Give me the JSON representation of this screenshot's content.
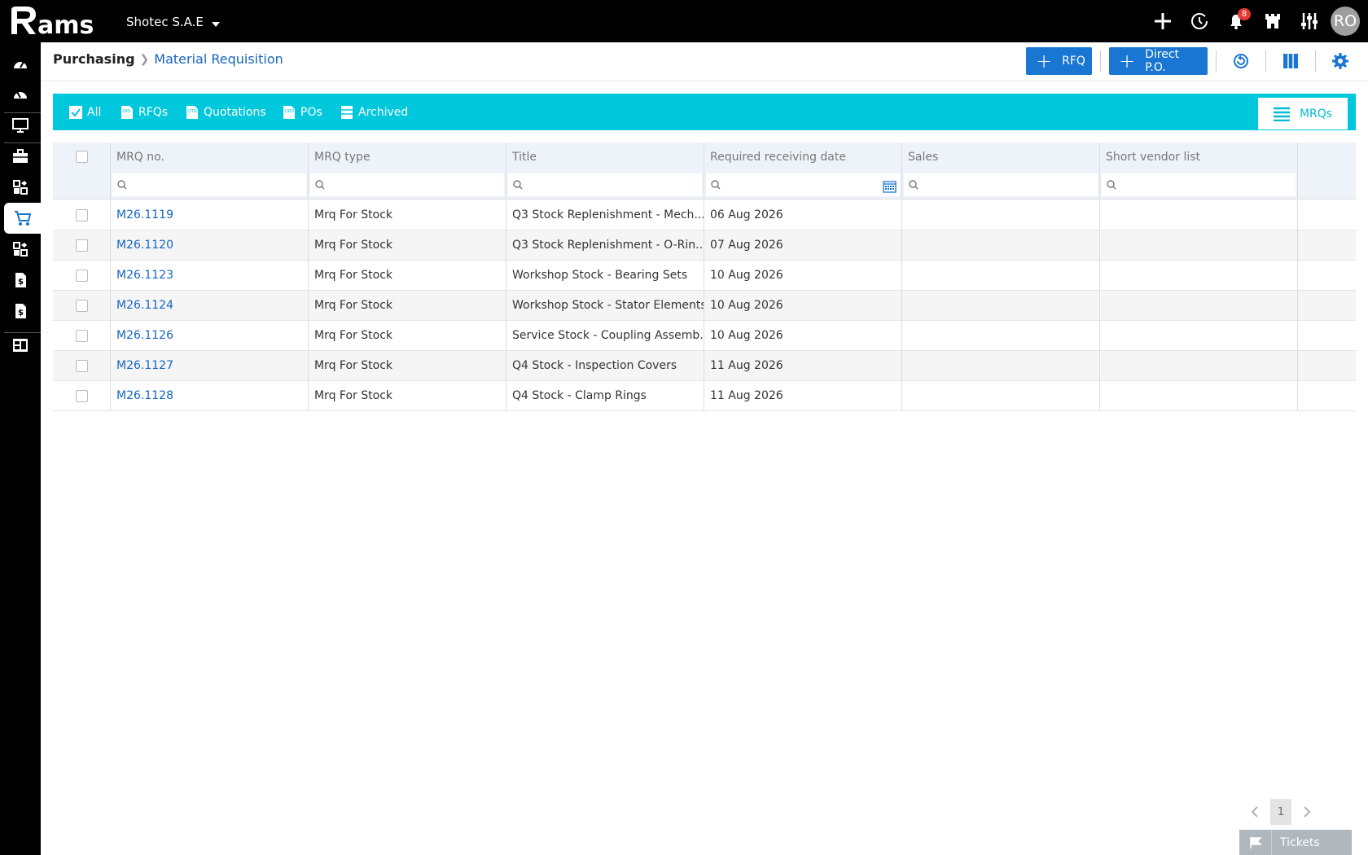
{
  "app": {
    "company": "Shotec S.A.E",
    "notification_count": "8",
    "user_initials": "RO"
  },
  "breadcrumb": {
    "root": "Purchasing",
    "current": "Material Requisition"
  },
  "actions": {
    "rfq_label": "RFQ",
    "direct_po_label": "Direct P.O."
  },
  "tabs": {
    "all": "All",
    "rfqs": "RFQs",
    "quotations": "Quotations",
    "pos": "POs",
    "archived": "Archived",
    "mrqs": "MRQs"
  },
  "table": {
    "columns": [
      "MRQ no.",
      "MRQ type",
      "Title",
      "Required receiving date",
      "Sales",
      "Short vendor list"
    ],
    "rows": [
      {
        "no": "M26.1119",
        "type": "Mrq For Stock",
        "title": "Q3 Stock Replenishment - Mech...",
        "date": "06 Aug 2026"
      },
      {
        "no": "M26.1120",
        "type": "Mrq For Stock",
        "title": "Q3 Stock Replenishment - O-Rin...",
        "date": "07 Aug 2026"
      },
      {
        "no": "M26.1123",
        "type": "Mrq For Stock",
        "title": "Workshop Stock - Bearing Sets",
        "date": "10 Aug 2026"
      },
      {
        "no": "M26.1124",
        "type": "Mrq For Stock",
        "title": "Workshop Stock - Stator Elements",
        "date": "10 Aug 2026"
      },
      {
        "no": "M26.1126",
        "type": "Mrq For Stock",
        "title": "Service Stock - Coupling Assemb...",
        "date": "10 Aug 2026"
      },
      {
        "no": "M26.1127",
        "type": "Mrq For Stock",
        "title": "Q4 Stock - Inspection Covers",
        "date": "11 Aug 2026"
      },
      {
        "no": "M26.1128",
        "type": "Mrq For Stock",
        "title": "Q4 Stock - Clamp Rings",
        "date": "11 Aug 2026"
      }
    ]
  },
  "pager": {
    "current_page": "1"
  },
  "tickets": {
    "label": "Tickets"
  },
  "colors": {
    "accent": "#00c8dc",
    "primary": "#1976d2",
    "link": "#1565c0"
  }
}
